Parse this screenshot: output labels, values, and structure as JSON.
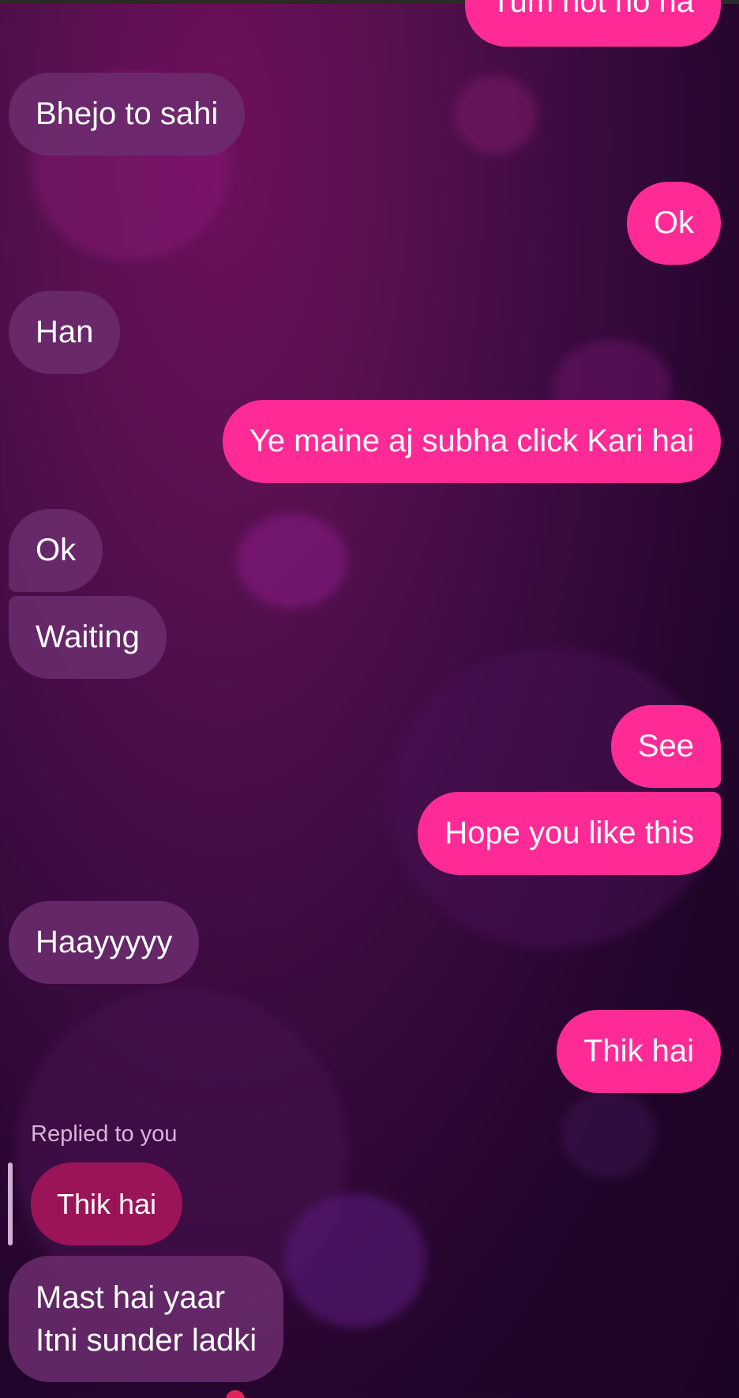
{
  "colors": {
    "incoming_bubble": "#6c2d6e",
    "outgoing_bubble": "#fe2b96",
    "quoted_bubble": "#9c1458",
    "background": "#3a0a3f"
  },
  "messages": [
    {
      "direction": "out",
      "text": "Tum hot ho na"
    },
    {
      "direction": "in",
      "text": "Bhejo to sahi"
    },
    {
      "direction": "out",
      "text": "Ok"
    },
    {
      "direction": "in",
      "text": "Han"
    },
    {
      "direction": "out",
      "text": "Ye maine aj subha click Kari hai"
    },
    {
      "direction": "in",
      "text": "Ok"
    },
    {
      "direction": "in",
      "text": "Waiting"
    },
    {
      "direction": "out",
      "text": "See"
    },
    {
      "direction": "out",
      "text": "Hope you like this"
    },
    {
      "direction": "in",
      "text": "Haayyyyy"
    },
    {
      "direction": "out",
      "text": "Thik hai"
    }
  ],
  "reply": {
    "label": "Replied to you",
    "quoted_text": "Thik hai",
    "lines": [
      "Mast hai yaar",
      "Itni sunder ladki"
    ]
  }
}
